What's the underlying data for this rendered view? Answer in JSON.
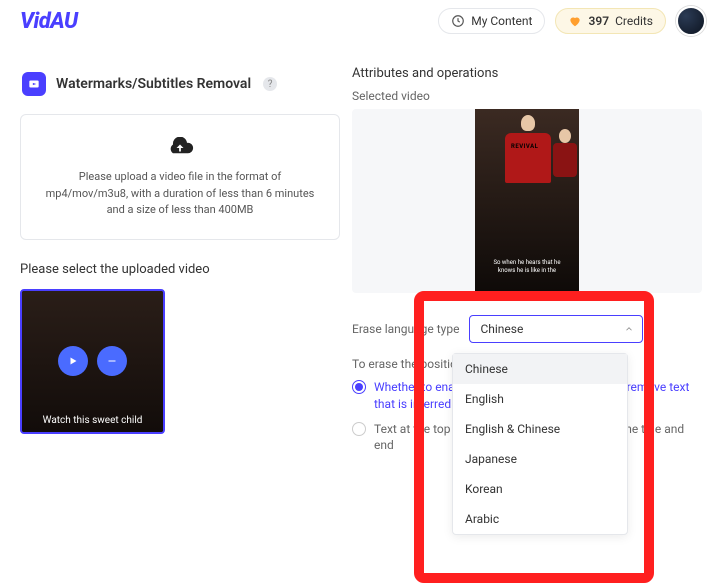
{
  "brand": "VidAU",
  "header": {
    "my_content_label": "My Content",
    "credits_count": "397",
    "credits_label": "Credits"
  },
  "left": {
    "feature_title": "Watermarks/Subtitles Removal",
    "upload_instructions": "Please upload a video file in the format of mp4/mov/m3u8, with a duration of less than 6 minutes and a size of less than 400MB",
    "select_uploaded_label": "Please select the uploaded video",
    "thumb_caption": "Watch this sweet child"
  },
  "right": {
    "section_title": "Attributes and operations",
    "selected_video_label": "Selected video",
    "preview_shirt_text": "REVIVAL",
    "preview_caption_l1": "So when he hears that he",
    "preview_caption_l2": "knows he is like in the",
    "erase_lang_label": "Erase language type",
    "selected_language": "Chinese",
    "erase_position_label": "To erase the position",
    "radio1_text": "Whether to enable enhanced subtitle erase and remove text that is inferred to be subtitles",
    "radio2_text": "Text at the top or bottom of the video, such as the title and end"
  },
  "dropdown": {
    "items": [
      {
        "label": "Chinese"
      },
      {
        "label": "English"
      },
      {
        "label": "English & Chinese"
      },
      {
        "label": "Japanese"
      },
      {
        "label": "Korean"
      },
      {
        "label": "Arabic"
      }
    ]
  }
}
